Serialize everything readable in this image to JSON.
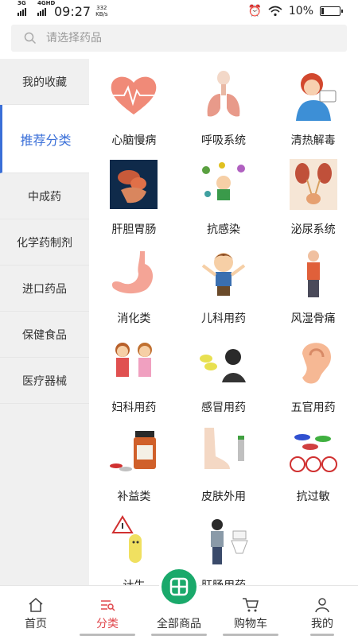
{
  "status_bar": {
    "network_1": "3G",
    "network_2": "4GHD",
    "time": "09:27",
    "speed_value": "332",
    "speed_unit": "KB/s",
    "battery": "10%"
  },
  "search": {
    "placeholder": "请选择药品",
    "icon": "search-icon"
  },
  "sidebar": {
    "items": [
      {
        "label": "我的收藏"
      },
      {
        "label": "推荐分类",
        "active": true
      },
      {
        "label": "中成药"
      },
      {
        "label": "化学药制剂"
      },
      {
        "label": "进口药品"
      },
      {
        "label": "保健食品"
      },
      {
        "label": "医疗器械"
      }
    ]
  },
  "categories": [
    {
      "label": "心脑慢病",
      "icon": "heart-icon"
    },
    {
      "label": "呼吸系统",
      "icon": "lungs-icon"
    },
    {
      "label": "清热解毒",
      "icon": "fever-person-icon"
    },
    {
      "label": "肝胆胃肠",
      "icon": "organs-icon"
    },
    {
      "label": "抗感染",
      "icon": "germs-child-icon"
    },
    {
      "label": "泌尿系统",
      "icon": "kidney-icon"
    },
    {
      "label": "消化类",
      "icon": "stomach-icon"
    },
    {
      "label": "儿科用药",
      "icon": "child-icon"
    },
    {
      "label": "风湿骨痛",
      "icon": "back-pain-icon"
    },
    {
      "label": "妇科用药",
      "icon": "women-icon"
    },
    {
      "label": "感冒用药",
      "icon": "cold-woman-icon"
    },
    {
      "label": "五官用药",
      "icon": "ear-icon"
    },
    {
      "label": "补益类",
      "icon": "supplement-bottle-icon"
    },
    {
      "label": "皮肤外用",
      "icon": "foot-spray-icon"
    },
    {
      "label": "抗过敏",
      "icon": "no-pills-icon"
    },
    {
      "label": "计生",
      "icon": "condom-icon"
    },
    {
      "label": "肛肠用药",
      "icon": "toilet-man-icon"
    }
  ],
  "tabbar": {
    "items": [
      {
        "label": "首页",
        "icon": "home-icon"
      },
      {
        "label": "分类",
        "icon": "category-icon",
        "active": true
      },
      {
        "label": "全部商品",
        "icon": "all-products-icon"
      },
      {
        "label": "购物车",
        "icon": "cart-icon"
      },
      {
        "label": "我的",
        "icon": "profile-icon"
      }
    ]
  },
  "colors": {
    "accent_blue": "#3a6fd8",
    "tab_active": "#e0474c",
    "center_button": "#1aa96b"
  }
}
